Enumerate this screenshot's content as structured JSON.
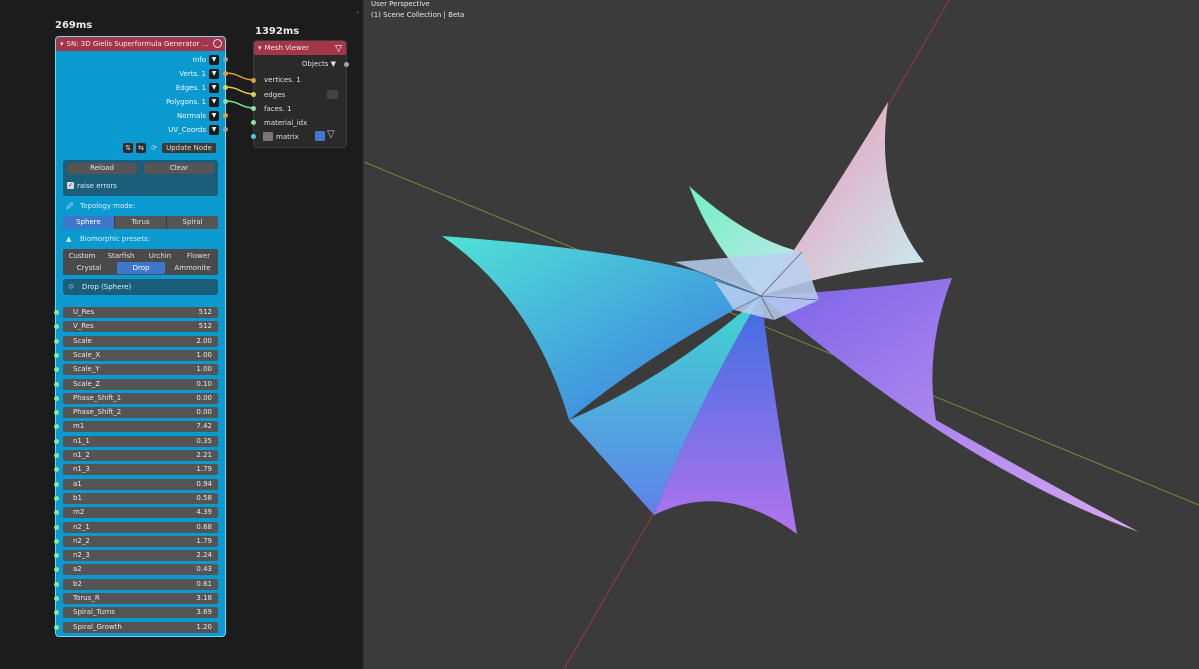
{
  "node_editor": {
    "timing_left": "269ms",
    "timing_right": "1392ms",
    "sn_node": {
      "title": "SN: 3D Gielis Superformula Generator ...",
      "outputs": [
        {
          "label": "Info"
        },
        {
          "label": "Verts. 1"
        },
        {
          "label": "Edges. 1"
        },
        {
          "label": "Polygons. 1"
        },
        {
          "label": "Normals"
        },
        {
          "label": "UV_Coords"
        }
      ],
      "update_label": "Update Node",
      "reload_label": "Reload",
      "clear_label": "Clear",
      "raise_errors_label": "raise errors",
      "topology_label": "Topology mode:",
      "topology_options": [
        "Sphere",
        "Torus",
        "Spiral"
      ],
      "topology_selected": "Sphere",
      "presets_label": "Biomorphic presets:",
      "presets_row1": [
        "Custom",
        "Starfish",
        "Urchin",
        "Flower"
      ],
      "presets_row2": [
        "Crystal",
        "Drop",
        "Ammonite"
      ],
      "preset_selected": "Drop",
      "current_preset": "Drop (Sphere)",
      "params": [
        {
          "name": "U_Res",
          "value": "512"
        },
        {
          "name": "V_Res",
          "value": "512"
        },
        {
          "name": "Scale",
          "value": "2.00"
        },
        {
          "name": "Scale_X",
          "value": "1.00"
        },
        {
          "name": "Scale_Y",
          "value": "1.00"
        },
        {
          "name": "Scale_Z",
          "value": "0.10"
        },
        {
          "name": "Phase_Shift_1",
          "value": "0.00"
        },
        {
          "name": "Phase_Shift_2",
          "value": "0.00"
        },
        {
          "name": "m1",
          "value": "7.42"
        },
        {
          "name": "n1_1",
          "value": "0.35"
        },
        {
          "name": "n1_2",
          "value": "2.21"
        },
        {
          "name": "n1_3",
          "value": "1.79"
        },
        {
          "name": "a1",
          "value": "0.94"
        },
        {
          "name": "b1",
          "value": "0.58"
        },
        {
          "name": "m2",
          "value": "4.39"
        },
        {
          "name": "n2_1",
          "value": "0.68"
        },
        {
          "name": "n2_2",
          "value": "1.79"
        },
        {
          "name": "n2_3",
          "value": "2.24"
        },
        {
          "name": "a2",
          "value": "0.43"
        },
        {
          "name": "b2",
          "value": "0.61"
        },
        {
          "name": "Torus_R",
          "value": "3.18"
        },
        {
          "name": "Spiral_Turns",
          "value": "3.69"
        },
        {
          "name": "Spiral_Growth",
          "value": "1.20"
        }
      ]
    },
    "mesh_viewer": {
      "title": "Mesh Viewer",
      "objects_label": "Objects",
      "inputs": [
        "vertices. 1",
        "edges",
        "faces. 1",
        "material_idx",
        "matrix"
      ]
    }
  },
  "viewport": {
    "perspective": "User Perspective",
    "collection": "(1) Scene Collection | Beta"
  },
  "colors": {
    "node_body": "#0a9ad0",
    "node_header": "#a3364b",
    "viewport_bg": "#3b3b3b",
    "active_button": "#3d77c9"
  }
}
